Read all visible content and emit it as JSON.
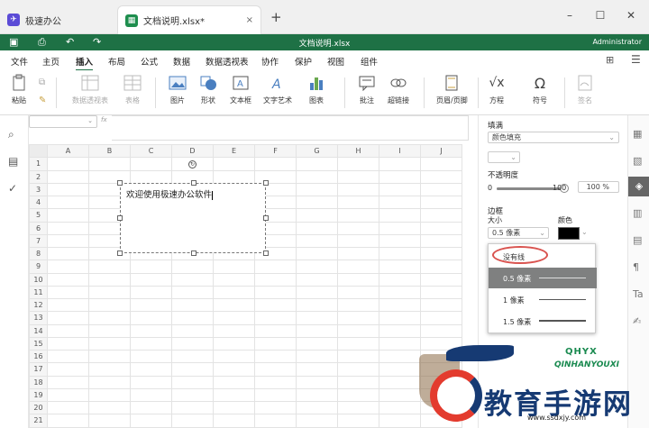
{
  "tabs": {
    "home_label": "极速办公",
    "doc_label": "文档说明.xlsx*",
    "close": "×",
    "new_tab": "+"
  },
  "window": {
    "minimize": "–",
    "maximize": "☐",
    "close": "✕"
  },
  "titlebar": {
    "doc_title": "文档说明.xlsx",
    "user": "Administrator"
  },
  "menu": [
    "文件",
    "主页",
    "插入",
    "布局",
    "公式",
    "数据",
    "数据透视表",
    "协作",
    "保护",
    "视图",
    "组件"
  ],
  "menu_active_index": 2,
  "ribbon": [
    {
      "label": "粘贴",
      "icon": "paste-icon",
      "disabled": false
    },
    {
      "label": "数据透视表",
      "icon": "pivot-table-icon",
      "disabled": true
    },
    {
      "label": "表格",
      "icon": "table-icon",
      "disabled": true
    },
    {
      "label": "图片",
      "icon": "image-icon",
      "disabled": false
    },
    {
      "label": "形状",
      "icon": "shape-icon",
      "disabled": false
    },
    {
      "label": "文本框",
      "icon": "textbox-icon",
      "disabled": false
    },
    {
      "label": "文字艺术",
      "icon": "text-art-icon",
      "disabled": false
    },
    {
      "label": "图表",
      "icon": "chart-icon",
      "disabled": false
    },
    {
      "label": "批注",
      "icon": "comment-icon",
      "disabled": false
    },
    {
      "label": "超链接",
      "icon": "hyperlink-icon",
      "disabled": false
    },
    {
      "label": "页眉/页脚",
      "icon": "header-footer-icon",
      "disabled": false
    },
    {
      "label": "方程",
      "icon": "equation-icon",
      "disabled": false
    },
    {
      "label": "符号",
      "icon": "symbol-icon",
      "disabled": false
    },
    {
      "label": "签名",
      "icon": "signature-icon",
      "disabled": true
    }
  ],
  "formula": {
    "fx": "fx"
  },
  "columns": [
    "A",
    "B",
    "C",
    "D",
    "E",
    "F",
    "G",
    "H",
    "I",
    "J"
  ],
  "rows": [
    "1",
    "2",
    "3",
    "4",
    "5",
    "6",
    "7",
    "8",
    "9",
    "10",
    "11",
    "12",
    "13",
    "14",
    "15",
    "16",
    "17",
    "18",
    "19",
    "20",
    "21"
  ],
  "textbox": {
    "text": "欢迎使用极速办公软件"
  },
  "panel": {
    "fill_label": "填满",
    "fill_value": "颜色填充",
    "opacity_label": "不透明度",
    "opacity_min": "0",
    "opacity_max": "100",
    "opacity_value": "100 %",
    "opacity_fraction": 1.0,
    "border_label": "边框",
    "size_label": "大小",
    "color_label": "颜色",
    "size_value": "0.5 像素",
    "color_value": "#000000",
    "dropdown": [
      {
        "label": "没有线",
        "width": 0
      },
      {
        "label": "0.5 像素",
        "width": 0.5,
        "selected": true
      },
      {
        "label": "1 像素",
        "width": 1
      },
      {
        "label": "1.5 像素",
        "width": 1.5
      }
    ]
  },
  "watermark": {
    "brand": "QHYX",
    "brand_sub": "QINHANYOUXI",
    "name": "教育手游网",
    "url": "www.ssdxjy.com"
  },
  "colors": {
    "accent": "#1e7145",
    "highlight": "#d9534f"
  }
}
